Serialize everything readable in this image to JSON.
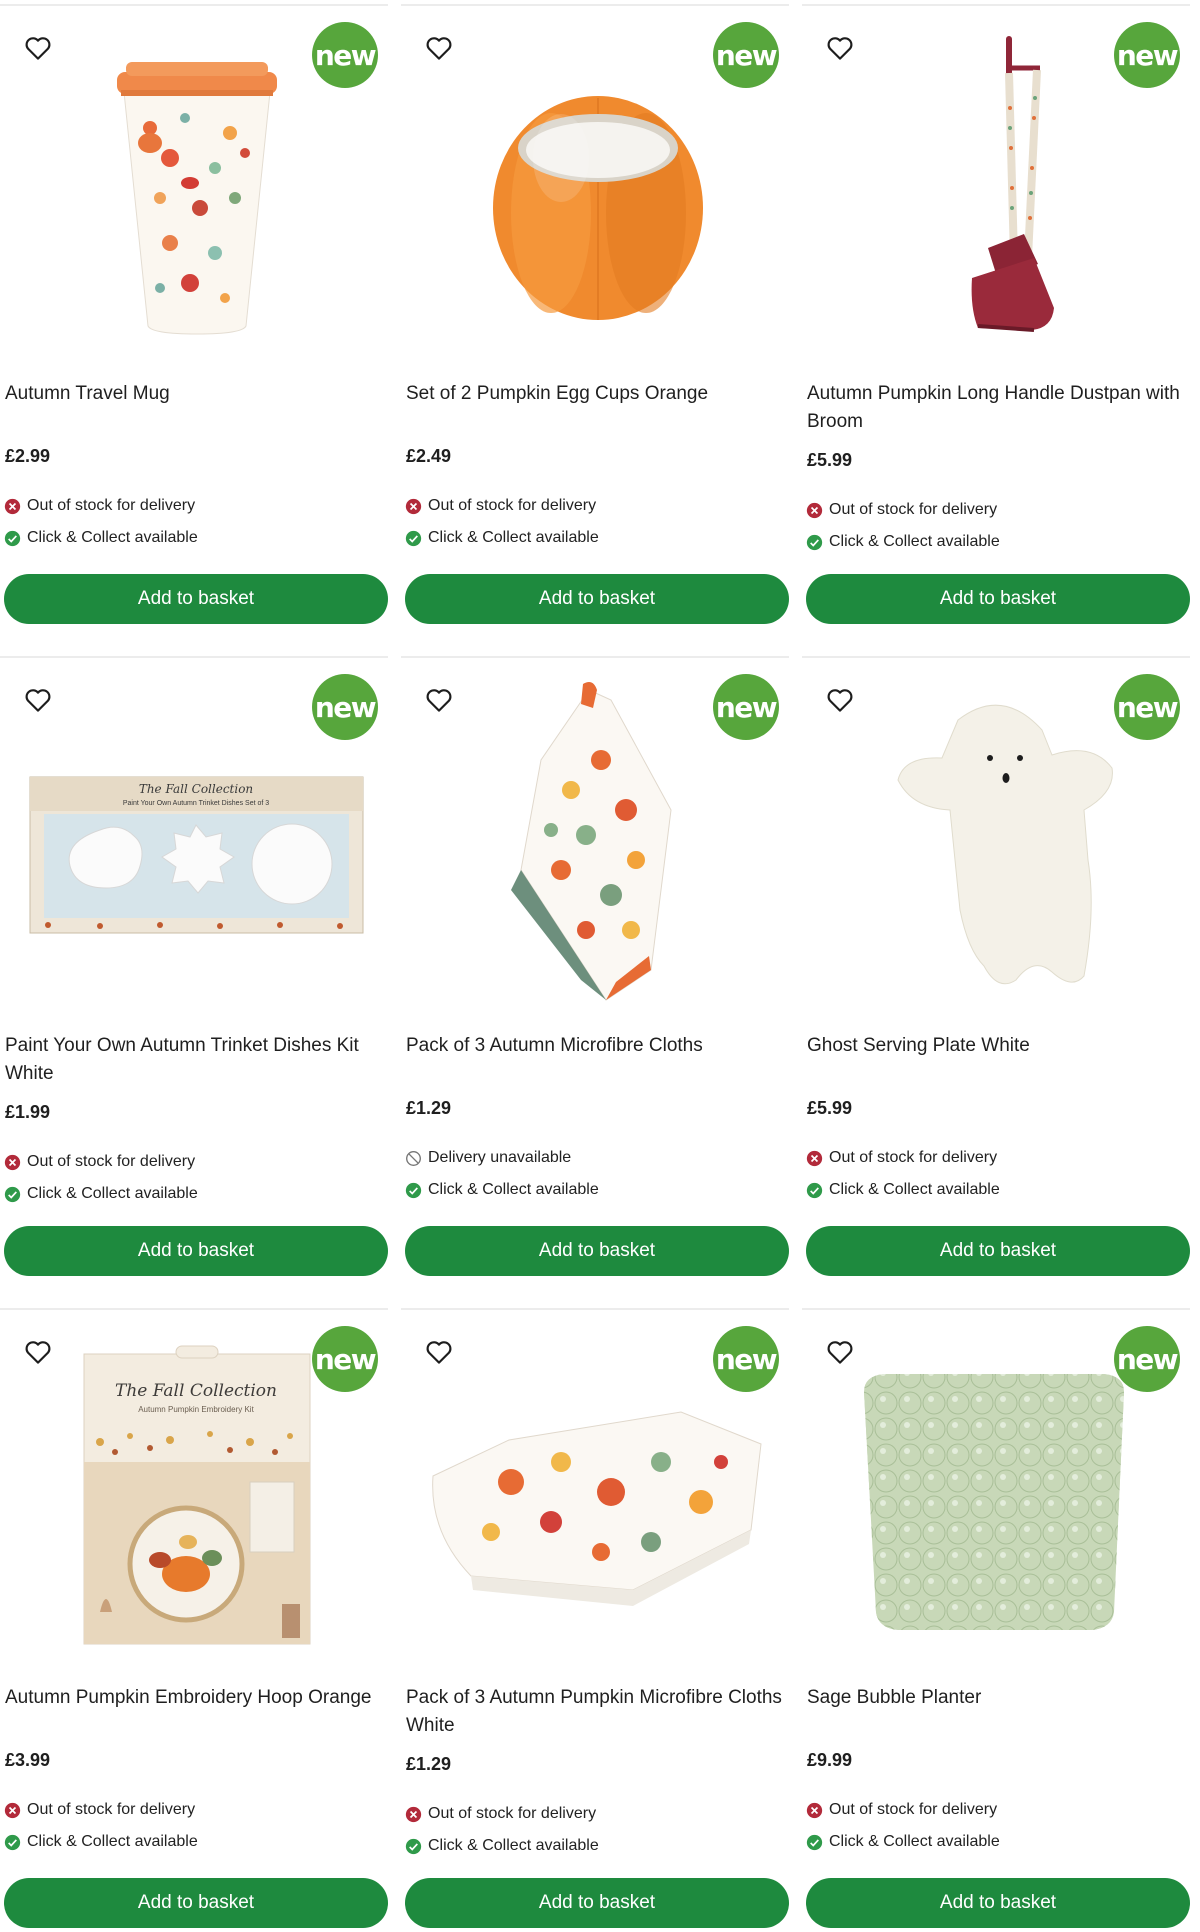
{
  "colors": {
    "accent": "#1e8a3e",
    "badge": "#57a63c",
    "out_of_stock": "#b22a3a",
    "available": "#2f9a4a"
  },
  "badge_label": "new",
  "button_label": "Add to basket",
  "products": [
    {
      "name": "Autumn Travel Mug",
      "price": "£2.99",
      "delivery": {
        "text": "Out of stock for delivery",
        "icon": "cross-circle-icon"
      },
      "collect": {
        "text": "Click & Collect available",
        "icon": "check-circle-icon"
      }
    },
    {
      "name": "Set of 2 Pumpkin Egg Cups Orange",
      "price": "£2.49",
      "delivery": {
        "text": "Out of stock for delivery",
        "icon": "cross-circle-icon"
      },
      "collect": {
        "text": "Click & Collect available",
        "icon": "check-circle-icon"
      }
    },
    {
      "name": "Autumn Pumpkin Long Handle Dustpan with Broom",
      "price": "£5.99",
      "delivery": {
        "text": "Out of stock for delivery",
        "icon": "cross-circle-icon"
      },
      "collect": {
        "text": "Click & Collect available",
        "icon": "check-circle-icon"
      }
    },
    {
      "name": "Paint Your Own Autumn Trinket Dishes Kit White",
      "price": "£1.99",
      "delivery": {
        "text": "Out of stock for delivery",
        "icon": "cross-circle-icon"
      },
      "collect": {
        "text": "Click & Collect available",
        "icon": "check-circle-icon"
      }
    },
    {
      "name": "Pack of 3 Autumn Microfibre Cloths",
      "price": "£1.29",
      "delivery": {
        "text": "Delivery unavailable",
        "icon": "unavailable-icon"
      },
      "collect": {
        "text": "Click & Collect available",
        "icon": "check-circle-icon"
      }
    },
    {
      "name": "Ghost Serving Plate White",
      "price": "£5.99",
      "delivery": {
        "text": "Out of stock for delivery",
        "icon": "cross-circle-icon"
      },
      "collect": {
        "text": "Click & Collect available",
        "icon": "check-circle-icon"
      }
    },
    {
      "name": "Autumn Pumpkin Embroidery Hoop Orange",
      "price": "£3.99",
      "delivery": {
        "text": "Out of stock for delivery",
        "icon": "cross-circle-icon"
      },
      "collect": {
        "text": "Click & Collect available",
        "icon": "check-circle-icon"
      }
    },
    {
      "name": "Pack of 3 Autumn Pumpkin Microfibre Cloths White",
      "price": "£1.29",
      "delivery": {
        "text": "Out of stock for delivery",
        "icon": "cross-circle-icon"
      },
      "collect": {
        "text": "Click & Collect available",
        "icon": "check-circle-icon"
      }
    },
    {
      "name": "Sage Bubble Planter",
      "price": "£9.99",
      "delivery": {
        "text": "Out of stock for delivery",
        "icon": "cross-circle-icon"
      },
      "collect": {
        "text": "Click & Collect available",
        "icon": "check-circle-icon"
      }
    }
  ],
  "image_text": {
    "trinket_box_title": "The Fall Collection",
    "trinket_box_subtitle": "Paint Your Own Autumn Trinket Dishes Set of 3",
    "embroidery_box_title": "The Fall Collection",
    "embroidery_box_subtitle": "Autumn Pumpkin Embroidery Kit"
  }
}
